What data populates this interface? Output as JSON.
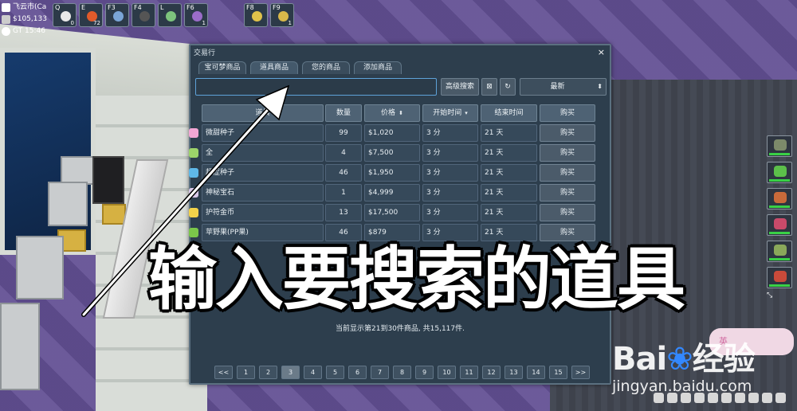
{
  "hud": {
    "location": "飞云市(Ca",
    "money": "$105,133",
    "time": "GT 15:46"
  },
  "hotbar": [
    {
      "key": "Q",
      "count": "0",
      "color": "#e8e8e8"
    },
    {
      "key": "E",
      "count": "72",
      "color": "#e05a2a"
    },
    {
      "key": "F3",
      "count": "",
      "color": "#7aa5d6"
    },
    {
      "key": "F4",
      "count": "",
      "color": "#555"
    },
    {
      "key": "L",
      "count": "",
      "color": "#7dc47d"
    },
    {
      "key": "F6",
      "count": "1",
      "color": "#9a6cc8"
    },
    {
      "key": "F8",
      "count": "",
      "color": "#e0c24a"
    },
    {
      "key": "F9",
      "count": "1",
      "color": "#d8b84a"
    }
  ],
  "window": {
    "title": "交易行",
    "close": "×",
    "tabs": [
      "宝可梦商品",
      "道具商品",
      "您的商品",
      "添加商品"
    ],
    "search_value": "",
    "advanced_search": "高级搜索",
    "clear_icon": "⊠",
    "refresh_icon": "↻",
    "sort_value": "最新",
    "headers": {
      "name": "道具",
      "qty": "数量",
      "price": "价格",
      "start": "开始时间",
      "end": "结束时间",
      "buy": "购买"
    },
    "rows": [
      {
        "name": "微甜种子",
        "qty": "99",
        "price": "$1,020",
        "start": "3 分",
        "end": "21 天",
        "buy": "购买",
        "icon_color": "#f2a6d4"
      },
      {
        "name": "全",
        "qty": "4",
        "price": "$7,500",
        "start": "3 分",
        "end": "21 天",
        "buy": "购买",
        "icon_color": "#9dd36a"
      },
      {
        "name": "超涩种子",
        "qty": "46",
        "price": "$1,950",
        "start": "3 分",
        "end": "21 天",
        "buy": "购买",
        "icon_color": "#5fb8e8"
      },
      {
        "name": "神秘宝石",
        "qty": "1",
        "price": "$4,999",
        "start": "3 分",
        "end": "21 天",
        "buy": "购买",
        "icon_color": "#d8c8e8"
      },
      {
        "name": "护符金币",
        "qty": "13",
        "price": "$17,500",
        "start": "3 分",
        "end": "21 天",
        "buy": "购买",
        "icon_color": "#f2d24a"
      },
      {
        "name": "苹野果(PP果)",
        "qty": "46",
        "price": "$879",
        "start": "3 分",
        "end": "21 天",
        "buy": "购买",
        "icon_color": "#7bc74a"
      }
    ],
    "status": "当前显示第21到30件商品, 共15,117件.",
    "pages": [
      "<<",
      "1",
      "2",
      "3",
      "4",
      "5",
      "6",
      "7",
      "8",
      "9",
      "10",
      "11",
      "12",
      "13",
      "14",
      "15",
      ">>"
    ],
    "current_page": "3"
  },
  "overlay_caption": "输入要搜索的道具",
  "party": [
    "#7c8a6a",
    "#5cbf4a",
    "#c86a3a",
    "#c84a6a",
    "#8aa85a",
    "#c84a3a"
  ],
  "party_expand": "⤡",
  "watermark": {
    "logo_left": "Bai",
    "logo_right": "经验",
    "url": "jingyan.baidu.com",
    "flower_text": "英"
  }
}
